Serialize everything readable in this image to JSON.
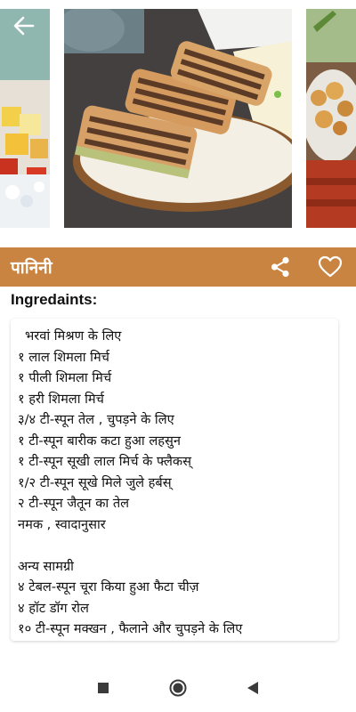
{
  "header": {
    "title": "पानिनी",
    "colors": {
      "accent": "#c98442",
      "on_accent": "#ffffff"
    },
    "icons": {
      "back": "arrow-left-icon",
      "share": "share-icon",
      "favorite": "heart-outline-icon"
    }
  },
  "recipe": {
    "section_label": "Ingredaints:",
    "ingredients": [
      " भरवां मिश्रण के लिए",
      "१ लाल शिमला मिर्च",
      "१ पीली शिमला मिर्च",
      "१ हरी शिमला मिर्च",
      "३/४ टी-स्पून तेल , चुपड़ने के लिए",
      "१ टी-स्पून बारीक कटा हुआ लहसुन",
      "१ टी-स्पून सूखी लाल मिर्च के फ्लैकस्",
      "१/२ टी-स्पून सूखे मिले जुले हर्बस्",
      "२ टी-स्पून जैतून का तेल",
      "नमक , स्वादानुसार",
      "",
      "अन्य सामग्री",
      "४ टेबल-स्पून चूरा किया हुआ फैटा चीज़",
      "४ हॉट डॉग रोल",
      "१० टी-स्पून मक्खन , फैलाने और चुपड़ने के लिए"
    ]
  },
  "nav": {
    "icons": {
      "recents": "square-icon",
      "home": "circle-icon",
      "back": "triangle-back-icon"
    }
  }
}
